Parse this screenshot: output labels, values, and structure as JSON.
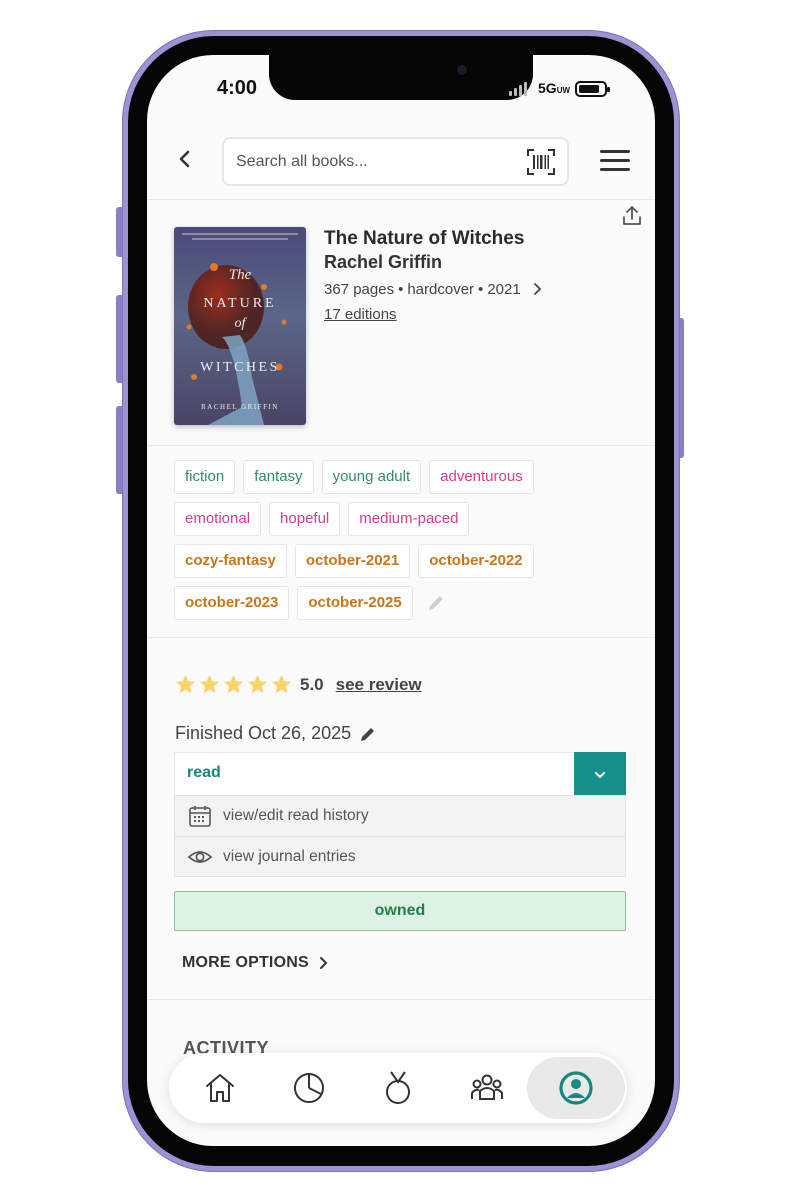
{
  "status_bar": {
    "time": "4:00",
    "network": "5G",
    "network_suffix": "UW",
    "battery_level": 0.85
  },
  "header": {
    "search_placeholder": "Search all books..."
  },
  "book": {
    "title": "The Nature of Witches",
    "author": "Rachel Griffin",
    "pages": "367 pages",
    "format": "hardcover",
    "year": "2021",
    "editions": "17 editions",
    "cover": {
      "title_line1": "The",
      "title_line2": "NATURE",
      "title_line3": "of",
      "title_line4": "WITCHES",
      "author": "RACHEL GRIFFIN"
    }
  },
  "tags": {
    "genres": [
      "fiction",
      "fantasy",
      "young adult"
    ],
    "moods": [
      "adventurous",
      "emotional",
      "hopeful",
      "medium-paced"
    ],
    "custom": [
      "cozy-fantasy",
      "october-2021",
      "october-2022",
      "october-2023",
      "october-2025"
    ]
  },
  "rating": {
    "stars": 5,
    "value": "5.0",
    "review_link": "see review"
  },
  "reading": {
    "finished": "Finished Oct 26, 2025",
    "status": "read",
    "menu": [
      "view/edit read history",
      "view journal entries"
    ],
    "owned_label": "owned",
    "more_options": "MORE OPTIONS"
  },
  "activity": {
    "label": "ACTIVITY"
  },
  "nav": {
    "items": [
      "home-icon",
      "stats-icon",
      "challenges-icon",
      "community-icon",
      "profile-icon"
    ],
    "active": "profile-icon"
  },
  "colors": {
    "frame": "#9d92d4",
    "genre": "#2e8b6f",
    "mood": "#d63b8f",
    "custom": "#c9761a",
    "accent": "#18908a",
    "owned_bg": "#dcf3e4",
    "star": "#f7d36b"
  }
}
